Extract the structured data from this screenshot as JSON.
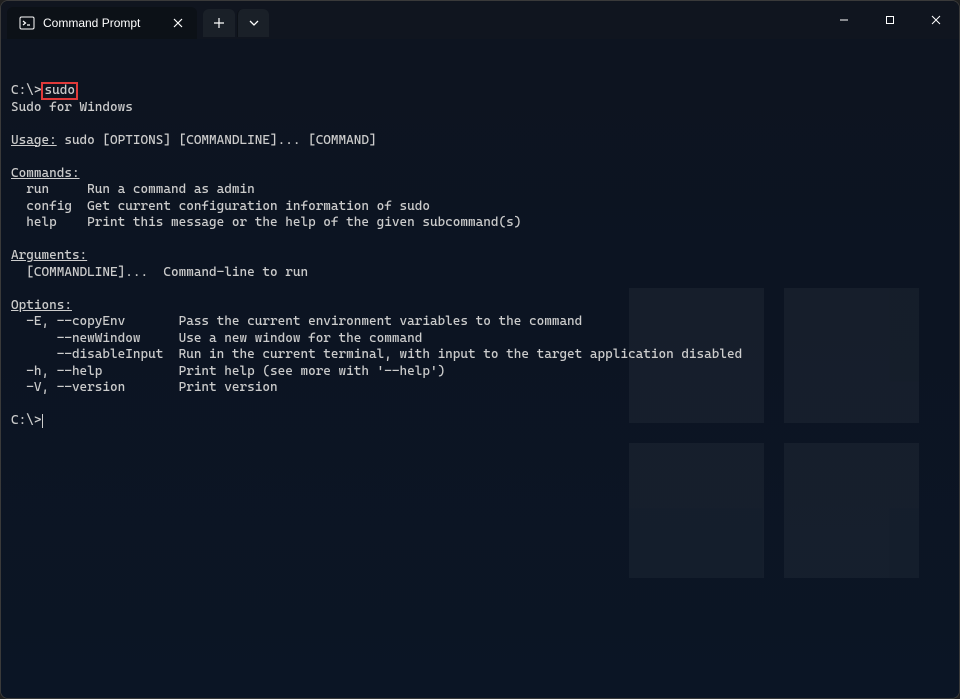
{
  "tab": {
    "title": "Command Prompt"
  },
  "terminal": {
    "prompt_prefix": "C:\\>",
    "typed_command": "sudo",
    "output_line1": "Sudo for Windows",
    "usage_label": "Usage:",
    "usage_text": " sudo [OPTIONS] [COMMANDLINE]... [COMMAND]",
    "commands_header": "Commands:",
    "commands": [
      {
        "name": "  run   ",
        "desc": "  Run a command as admin"
      },
      {
        "name": "  config",
        "desc": "  Get current configuration information of sudo"
      },
      {
        "name": "  help  ",
        "desc": "  Print this message or the help of the given subcommand(s)"
      }
    ],
    "arguments_header": "Arguments:",
    "arguments_line": "  [COMMANDLINE]...  Command-line to run",
    "options_header": "Options:",
    "options": [
      {
        "flags": "  -E, --copyEnv     ",
        "desc": "  Pass the current environment variables to the command"
      },
      {
        "flags": "      --newWindow   ",
        "desc": "  Use a new window for the command"
      },
      {
        "flags": "      --disableInput",
        "desc": "  Run in the current terminal, with input to the target application disabled"
      },
      {
        "flags": "  -h, --help        ",
        "desc": "  Print help (see more with '--help')"
      },
      {
        "flags": "  -V, --version     ",
        "desc": "  Print version"
      }
    ],
    "final_prompt": "C:\\>"
  }
}
